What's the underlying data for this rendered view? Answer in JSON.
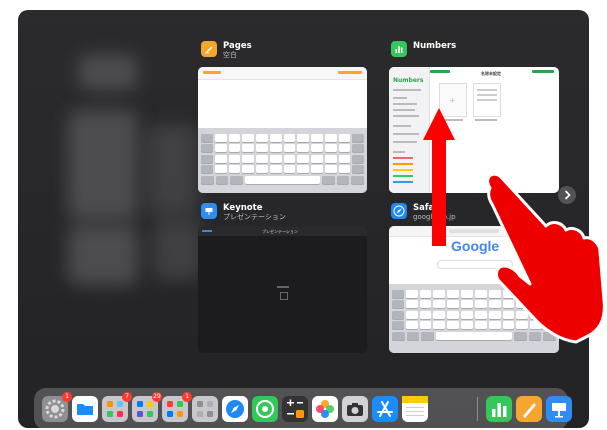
{
  "cards": {
    "pages": {
      "title": "Pages",
      "subtitle": "空白"
    },
    "numbers": {
      "title": "Numbers",
      "sidebar_title": "Numbers",
      "doc_title": "名称未設定"
    },
    "keynote": {
      "title": "Keynote",
      "subtitle": "プレゼンテーション",
      "doc_title": "プレゼンテーション"
    },
    "safari": {
      "title": "Safari",
      "subtitle": "google.co.jp",
      "page_logo": "Google"
    }
  },
  "dock": {
    "badges": {
      "settings": "1",
      "app_folder_1": "7",
      "app_folder_2": "29",
      "app_folder_3": "1"
    }
  },
  "annotation": {
    "arrow_color": "#ff0000",
    "hand_color": "#ee0000"
  }
}
